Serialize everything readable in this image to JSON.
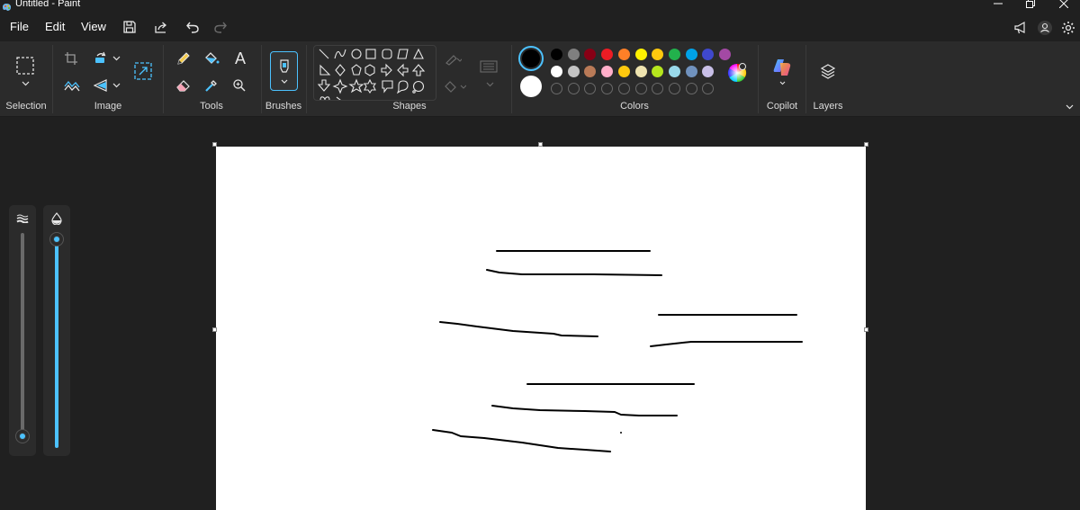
{
  "window": {
    "title": "Untitled - Paint"
  },
  "menu": {
    "file": "File",
    "edit": "Edit",
    "view": "View"
  },
  "ribbon": {
    "groups": {
      "selection": "Selection",
      "image": "Image",
      "tools": "Tools",
      "brushes": "Brushes",
      "shapes": "Shapes",
      "colors": "Colors",
      "copilot": "Copilot",
      "layers": "Layers"
    },
    "tools": {
      "text_glyph": "A"
    },
    "colors": {
      "primary": "#000000",
      "secondary": "#ffffff",
      "palette_row1": [
        "#000000",
        "#7f7f7f",
        "#880015",
        "#ed1c24",
        "#ff7f27",
        "#fff200",
        "#ffc90e",
        "#22b14c",
        "#00a2e8",
        "#3f48cc",
        "#a349a4"
      ],
      "palette_row2": [
        "#ffffff",
        "#c3c3c3",
        "#b97a57",
        "#ffaec9",
        "#ffc90e",
        "#efe4b0",
        "#b5e61d",
        "#99d9ea",
        "#7092be",
        "#c8bfe7"
      ],
      "accent": "#4cc2ff"
    }
  },
  "canvas": {
    "background": "#ffffff"
  },
  "sliders": {
    "size": {
      "icon": "stroke-size-icon",
      "level": 0.0
    },
    "opacity": {
      "icon": "opacity-drop-icon",
      "level": 1.0
    }
  }
}
